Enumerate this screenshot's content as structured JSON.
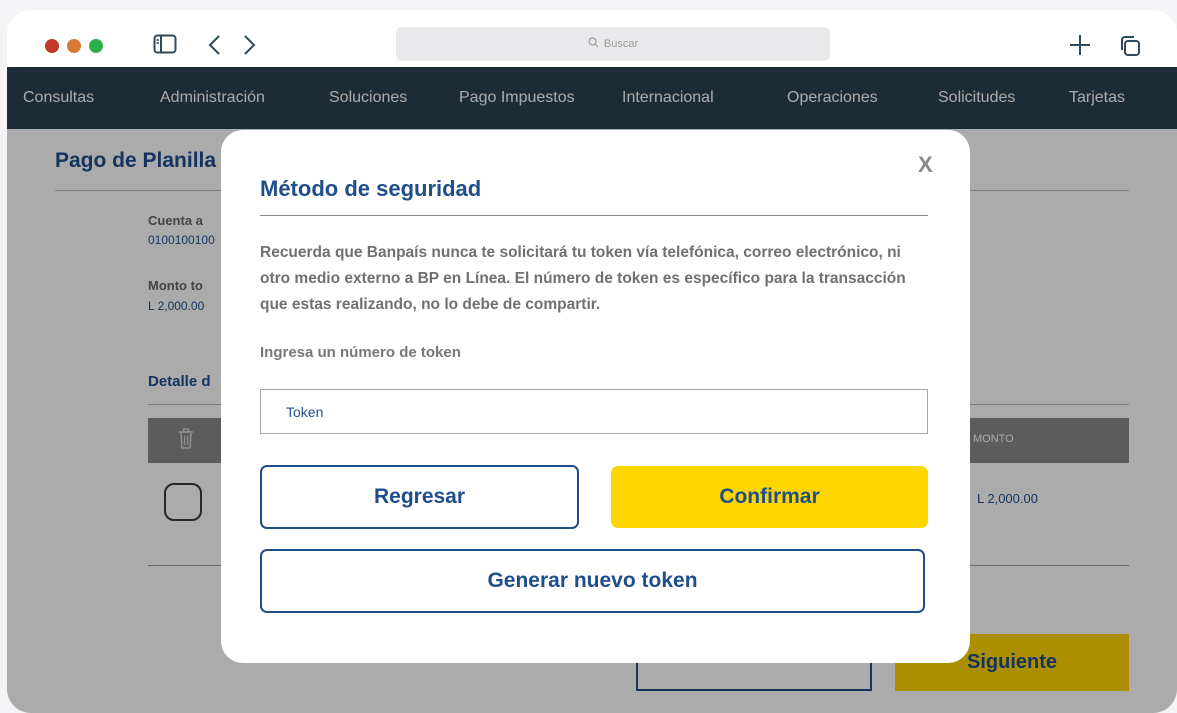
{
  "browser": {
    "search_placeholder": "Buscar"
  },
  "nav": {
    "items": [
      "Consultas",
      "Administración",
      "Soluciones",
      "Pago Impuestos",
      "Internacional",
      "Operaciones",
      "Solicitudes",
      "Tarjetas"
    ]
  },
  "page": {
    "title": "Pago de Planilla",
    "account_label": "Cuenta a",
    "account_value": "0100100100",
    "amount_label": "Monto to",
    "amount_value": "L 2,000.00",
    "detail_title": "Detalle d",
    "table_header_monto": "MONTO",
    "row_monto": "L 2,000.00",
    "next_button": "Siguiente"
  },
  "modal": {
    "title": "Método de seguridad",
    "close": "X",
    "notice": "Recuerda que Banpaís nunca te solicitará tu token vía telefónica, correo electrónico, ni otro medio externo a BP en Línea. El número de token es específico para la transacción que estas realizando, no lo debe de compartir.",
    "token_label": "Ingresa un número de token",
    "token_placeholder": "Token",
    "back_button": "Regresar",
    "confirm_button": "Confirmar",
    "new_token_button": "Generar nuevo token"
  },
  "colors": {
    "brand_blue": "#1f4e8c",
    "nav_bg": "#2b4252",
    "accent_yellow": "#ffd500"
  },
  "icons": [
    "sidebar-icon",
    "chevron-left-icon",
    "chevron-right-icon",
    "search-icon",
    "plus-icon",
    "tabs-icon",
    "trash-icon",
    "close-icon"
  ]
}
